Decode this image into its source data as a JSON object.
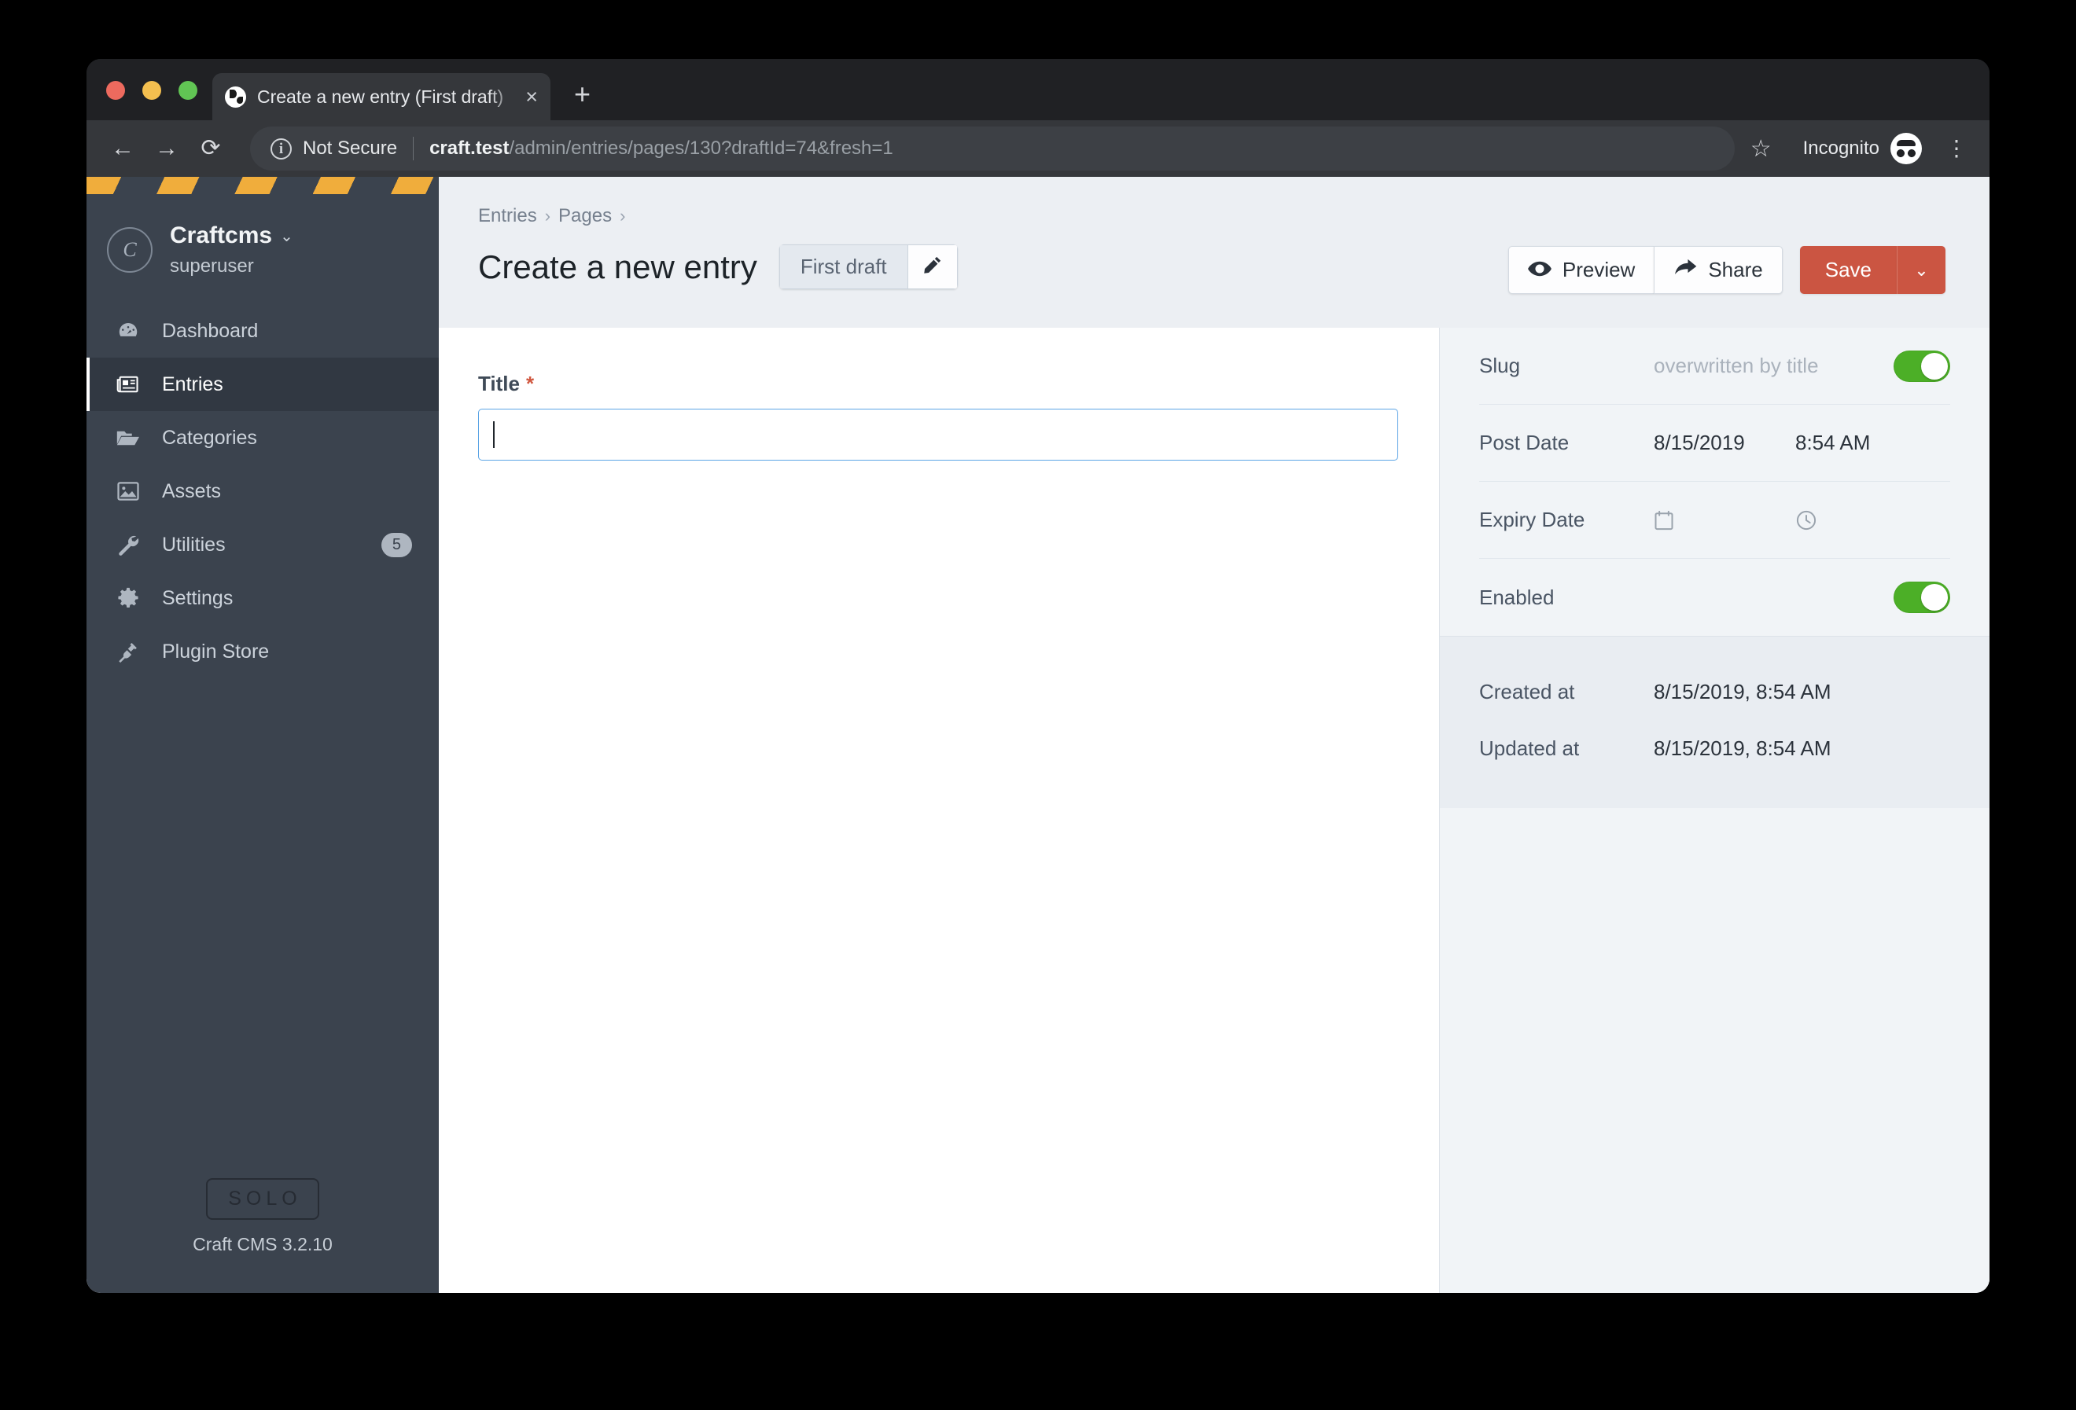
{
  "browser": {
    "tab": {
      "title": "Create a new entry (First draft)",
      "close_label": "×",
      "favicon": "globe-icon"
    },
    "new_tab_label": "+",
    "nav": {
      "back": "←",
      "forward": "→",
      "reload": "⟳"
    },
    "security_label": "Not Secure",
    "info_icon_glyph": "i",
    "url": {
      "host": "craft.test",
      "path": "/admin/entries/pages/130?draftId=74&fresh=1"
    },
    "star_glyph": "☆",
    "profile_label": "Incognito",
    "menu_glyph": "⋮"
  },
  "sidebar": {
    "site": {
      "avatar_letter": "C",
      "name": "Craftcms",
      "chevron": "⌄",
      "role": "superuser"
    },
    "items": [
      {
        "label": "Dashboard",
        "icon": "gauge-icon",
        "active": false,
        "badge": ""
      },
      {
        "label": "Entries",
        "icon": "newspaper-icon",
        "active": true,
        "badge": ""
      },
      {
        "label": "Categories",
        "icon": "folder-icon",
        "active": false,
        "badge": ""
      },
      {
        "label": "Assets",
        "icon": "image-icon",
        "active": false,
        "badge": ""
      },
      {
        "label": "Utilities",
        "icon": "wrench-icon",
        "active": false,
        "badge": "5"
      },
      {
        "label": "Settings",
        "icon": "gear-icon",
        "active": false,
        "badge": ""
      },
      {
        "label": "Plugin Store",
        "icon": "plug-icon",
        "active": false,
        "badge": ""
      }
    ],
    "footer": {
      "edition": "SOLO",
      "version": "Craft CMS 3.2.10"
    }
  },
  "header": {
    "breadcrumb": [
      "Entries",
      "Pages"
    ],
    "breadcrumb_separator": "›",
    "title": "Create a new entry",
    "draft_chip": "First draft",
    "draft_edit_icon": "pencil-icon",
    "preview_label": "Preview",
    "share_label": "Share",
    "save_label": "Save",
    "save_menu_chevron": "⌄"
  },
  "main": {
    "title_field": {
      "label": "Title",
      "required_marker": "*",
      "value": "",
      "placeholder": ""
    }
  },
  "meta": {
    "slug": {
      "label": "Slug",
      "placeholder": "overwritten by title",
      "toggle_on": true
    },
    "post_date": {
      "label": "Post Date",
      "date": "8/15/2019",
      "time": "8:54 AM"
    },
    "expiry_date": {
      "label": "Expiry Date",
      "date": "",
      "time": "",
      "date_icon": "calendar-icon",
      "time_icon": "clock-icon"
    },
    "enabled": {
      "label": "Enabled",
      "toggle_on": true
    },
    "created_at": {
      "label": "Created at",
      "value": "8/15/2019, 8:54 AM"
    },
    "updated_at": {
      "label": "Updated at",
      "value": "8/15/2019, 8:54 AM"
    }
  },
  "colors": {
    "accent_red": "#cb5542",
    "toggle_green": "#4caf27",
    "sidebar_bg": "#3b434e",
    "focus_blue": "#5ba4e5",
    "hazard_orange": "#f0ad3c"
  }
}
